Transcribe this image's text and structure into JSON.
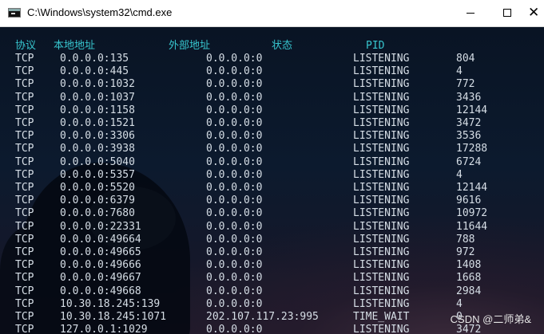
{
  "window": {
    "title": "C:\\Windows\\system32\\cmd.exe",
    "icon": "console-icon",
    "controls": {
      "minimize": "minimize-icon",
      "maximize": "maximize-icon",
      "close": "close-icon"
    }
  },
  "console": {
    "headers": {
      "protocol": "协议",
      "local": "本地地址",
      "foreign": "外部地址",
      "state": "状态",
      "pid": "PID"
    },
    "rows": [
      {
        "protocol": "TCP",
        "local": "0.0.0.0:135",
        "foreign": "0.0.0.0:0",
        "state": "LISTENING",
        "pid": "804"
      },
      {
        "protocol": "TCP",
        "local": "0.0.0.0:445",
        "foreign": "0.0.0.0:0",
        "state": "LISTENING",
        "pid": "4"
      },
      {
        "protocol": "TCP",
        "local": "0.0.0.0:1032",
        "foreign": "0.0.0.0:0",
        "state": "LISTENING",
        "pid": "772"
      },
      {
        "protocol": "TCP",
        "local": "0.0.0.0:1037",
        "foreign": "0.0.0.0:0",
        "state": "LISTENING",
        "pid": "3436"
      },
      {
        "protocol": "TCP",
        "local": "0.0.0.0:1158",
        "foreign": "0.0.0.0:0",
        "state": "LISTENING",
        "pid": "12144"
      },
      {
        "protocol": "TCP",
        "local": "0.0.0.0:1521",
        "foreign": "0.0.0.0:0",
        "state": "LISTENING",
        "pid": "3472"
      },
      {
        "protocol": "TCP",
        "local": "0.0.0.0:3306",
        "foreign": "0.0.0.0:0",
        "state": "LISTENING",
        "pid": "3536"
      },
      {
        "protocol": "TCP",
        "local": "0.0.0.0:3938",
        "foreign": "0.0.0.0:0",
        "state": "LISTENING",
        "pid": "17288"
      },
      {
        "protocol": "TCP",
        "local": "0.0.0.0:5040",
        "foreign": "0.0.0.0:0",
        "state": "LISTENING",
        "pid": "6724"
      },
      {
        "protocol": "TCP",
        "local": "0.0.0.0:5357",
        "foreign": "0.0.0.0:0",
        "state": "LISTENING",
        "pid": "4"
      },
      {
        "protocol": "TCP",
        "local": "0.0.0.0:5520",
        "foreign": "0.0.0.0:0",
        "state": "LISTENING",
        "pid": "12144"
      },
      {
        "protocol": "TCP",
        "local": "0.0.0.0:6379",
        "foreign": "0.0.0.0:0",
        "state": "LISTENING",
        "pid": "9616"
      },
      {
        "protocol": "TCP",
        "local": "0.0.0.0:7680",
        "foreign": "0.0.0.0:0",
        "state": "LISTENING",
        "pid": "10972"
      },
      {
        "protocol": "TCP",
        "local": "0.0.0.0:22331",
        "foreign": "0.0.0.0:0",
        "state": "LISTENING",
        "pid": "11644"
      },
      {
        "protocol": "TCP",
        "local": "0.0.0.0:49664",
        "foreign": "0.0.0.0:0",
        "state": "LISTENING",
        "pid": "788"
      },
      {
        "protocol": "TCP",
        "local": "0.0.0.0:49665",
        "foreign": "0.0.0.0:0",
        "state": "LISTENING",
        "pid": "972"
      },
      {
        "protocol": "TCP",
        "local": "0.0.0.0:49666",
        "foreign": "0.0.0.0:0",
        "state": "LISTENING",
        "pid": "1408"
      },
      {
        "protocol": "TCP",
        "local": "0.0.0.0:49667",
        "foreign": "0.0.0.0:0",
        "state": "LISTENING",
        "pid": "1668"
      },
      {
        "protocol": "TCP",
        "local": "0.0.0.0:49668",
        "foreign": "0.0.0.0:0",
        "state": "LISTENING",
        "pid": "2984"
      },
      {
        "protocol": "TCP",
        "local": "10.30.18.245:139",
        "foreign": "0.0.0.0:0",
        "state": "LISTENING",
        "pid": "4"
      },
      {
        "protocol": "TCP",
        "local": "10.30.18.245:1071",
        "foreign": "202.107.117.23:995",
        "state": "TIME_WAIT",
        "pid": "0"
      },
      {
        "protocol": "TCP",
        "local": "127.0.0.1:1029",
        "foreign": "0.0.0.0:0",
        "state": "LISTENING",
        "pid": "3472"
      }
    ]
  },
  "watermark": "CSDN @二师弟&",
  "colors": {
    "text": "#d6dee6",
    "header": "#37c6cf",
    "background": "#0b1526"
  }
}
